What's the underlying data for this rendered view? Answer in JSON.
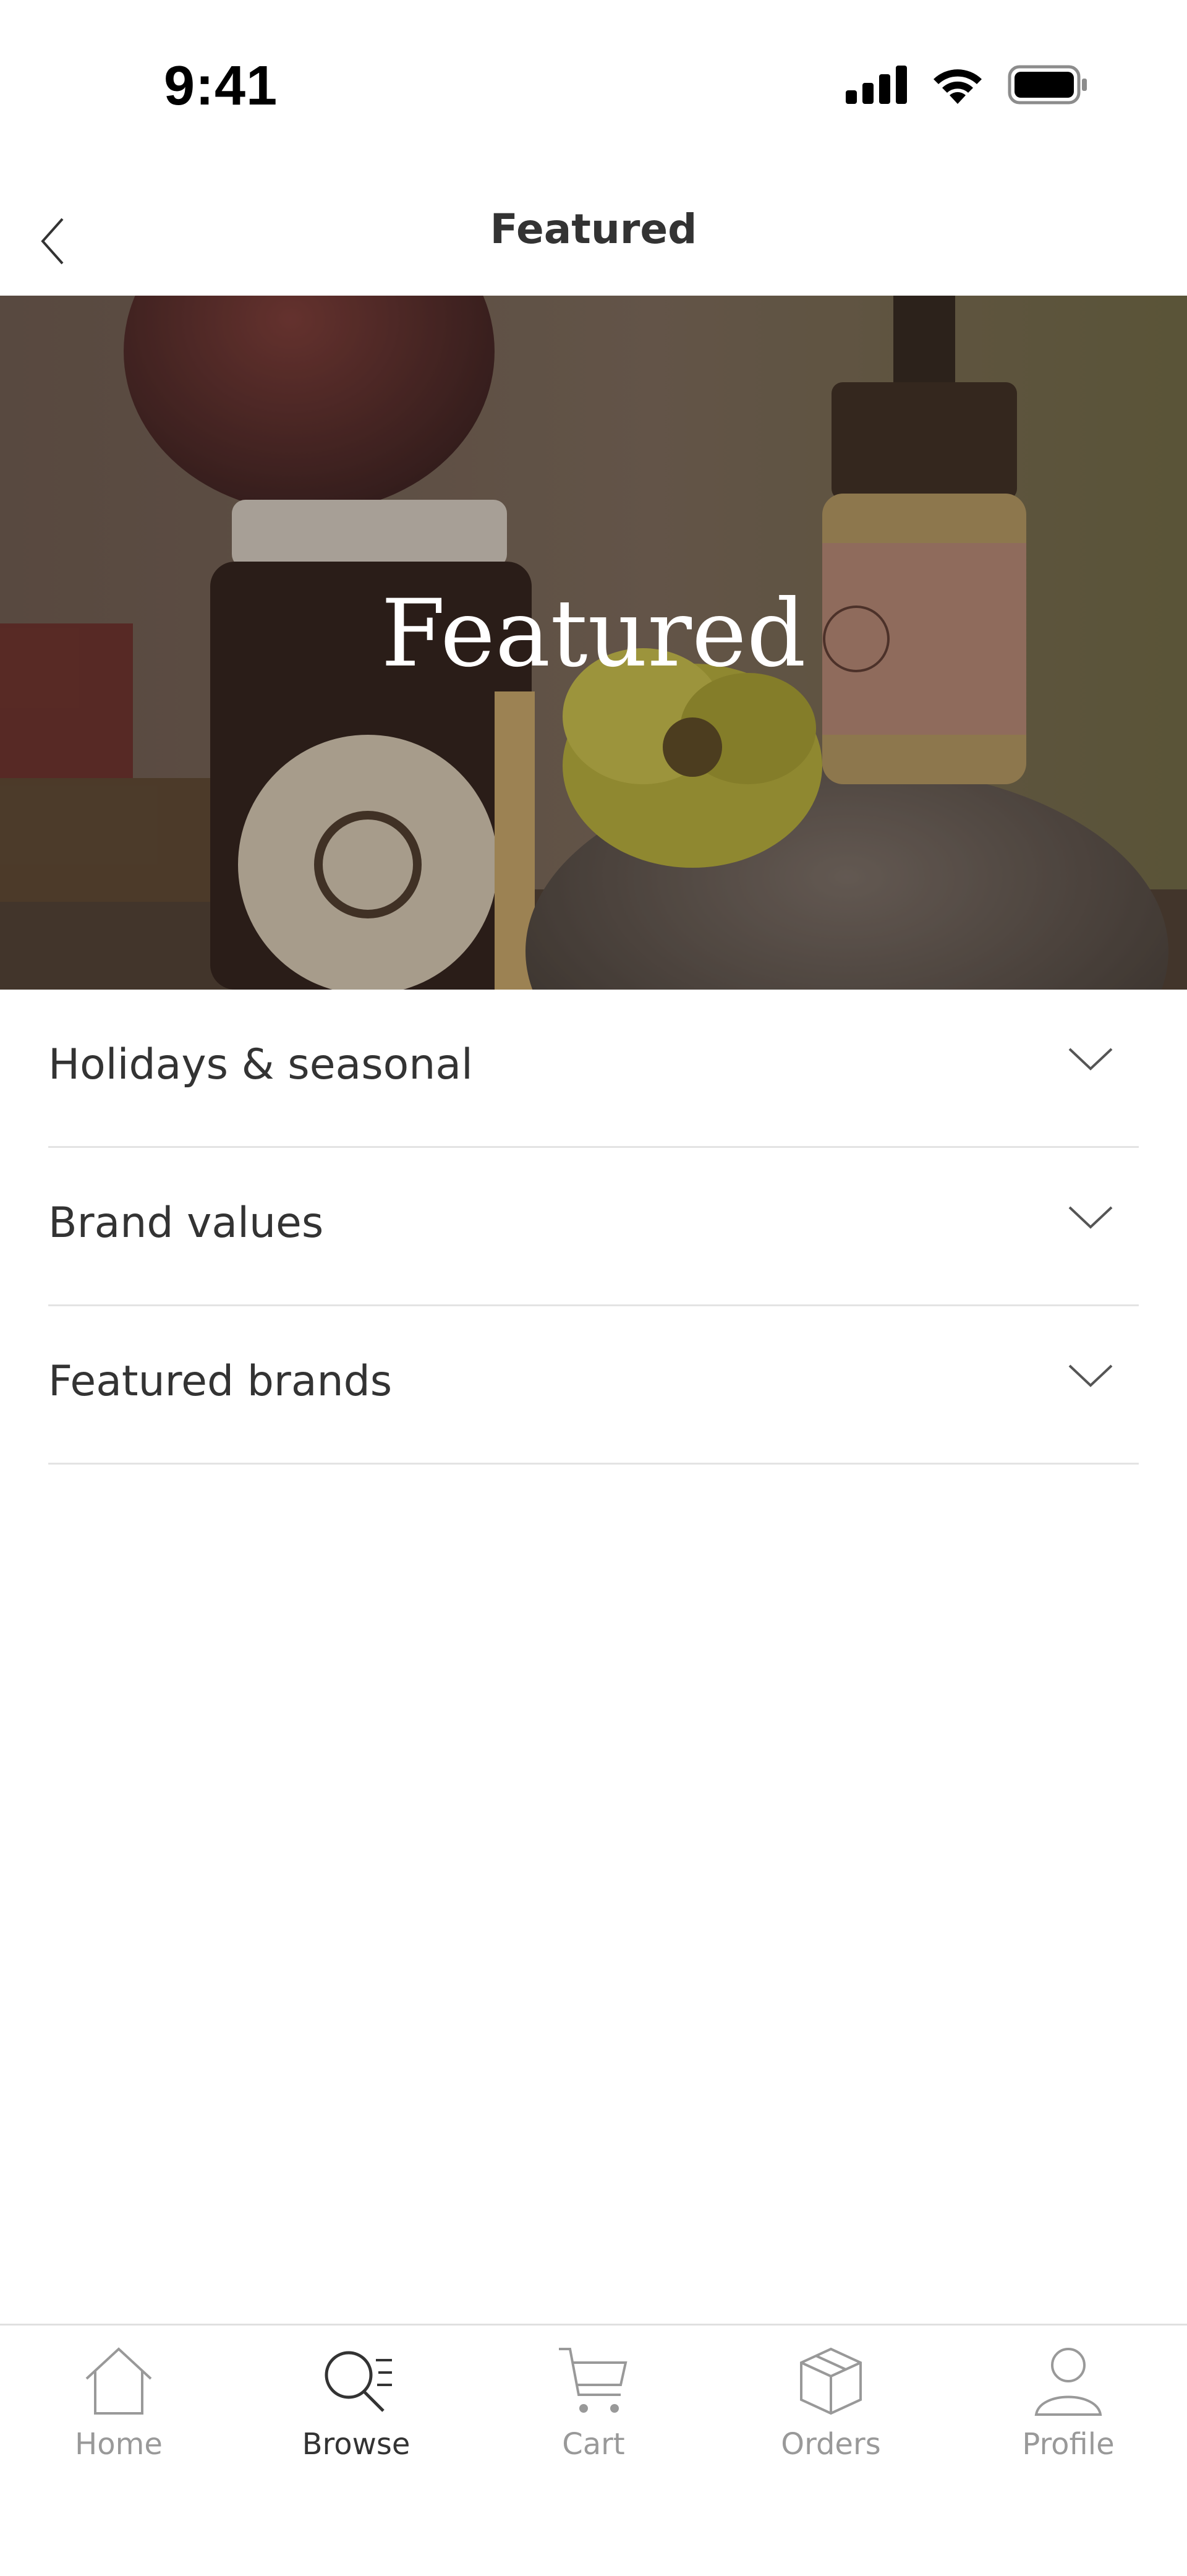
{
  "status_bar": {
    "time": "9:41",
    "icons": [
      "signal-icon",
      "wifi-icon",
      "battery-icon"
    ]
  },
  "nav": {
    "title": "Featured",
    "back_icon": "chevron-left-icon"
  },
  "hero": {
    "title": "Featured"
  },
  "accordion": {
    "items": [
      {
        "label": "Holidays & seasonal",
        "icon": "chevron-down-icon"
      },
      {
        "label": "Brand values",
        "icon": "chevron-down-icon"
      },
      {
        "label": "Featured brands",
        "icon": "chevron-down-icon"
      }
    ]
  },
  "tab_bar": {
    "active": "Browse",
    "tabs": [
      {
        "label": "Home",
        "icon": "home-icon"
      },
      {
        "label": "Browse",
        "icon": "search-icon"
      },
      {
        "label": "Cart",
        "icon": "cart-icon"
      },
      {
        "label": "Orders",
        "icon": "box-icon"
      },
      {
        "label": "Profile",
        "icon": "profile-icon"
      }
    ]
  },
  "colors": {
    "text": "#333333",
    "muted": "#999999",
    "divider": "#e3e3e3",
    "background": "#ffffff"
  }
}
